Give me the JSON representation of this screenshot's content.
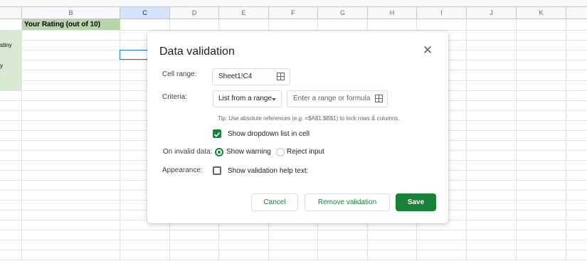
{
  "sheet": {
    "columns": [
      "B",
      "C",
      "D",
      "E",
      "F",
      "G",
      "H",
      "I",
      "J",
      "K"
    ],
    "selected_column": "C",
    "header_cell_text": "Your Rating (out of 10)",
    "row_fragments": [
      "stiny",
      "y"
    ]
  },
  "dialog": {
    "title": "Data validation",
    "close_icon": "close-icon",
    "cell_range_label": "Cell range:",
    "cell_range_value": "Sheet1!C4",
    "criteria_label": "Criteria:",
    "criteria_type": "List from a range",
    "range_placeholder": "Enter a range or formula",
    "tip": "Tip: Use absolute references (e.g. =$A$1:$B$1) to lock rows & columns.",
    "show_dropdown_label": "Show dropdown list in cell",
    "show_dropdown_checked": true,
    "invalid_data_label": "On invalid data:",
    "invalid_options": [
      "Show warning",
      "Reject input"
    ],
    "invalid_selected": "Show warning",
    "appearance_label": "Appearance:",
    "help_text_label": "Show validation help text:",
    "help_text_checked": false,
    "buttons": {
      "cancel": "Cancel",
      "remove": "Remove validation",
      "save": "Save"
    }
  },
  "colors": {
    "accent": "#188038",
    "header_fill": "#b6d7a8",
    "selection": "#1a73e8"
  }
}
